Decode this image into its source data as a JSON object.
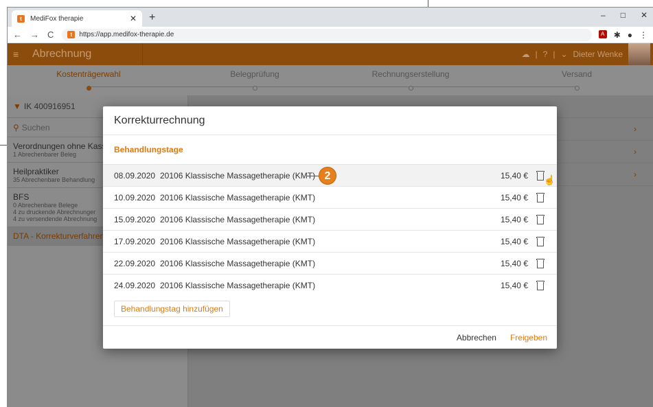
{
  "browser": {
    "tab_title": "MediFox therapie",
    "tab_favicon": "t",
    "url": "https://app.medifox-therapie.de",
    "new_tab": "+",
    "window_controls": [
      "–",
      "□",
      "✕"
    ]
  },
  "header": {
    "menu_icon": "≡",
    "title": "Abrechnung",
    "user": "Dieter Wenke"
  },
  "steps": [
    {
      "label": "Kostenträgerwahl"
    },
    {
      "label": "Belegprüfung"
    },
    {
      "label": "Rechnungserstellung"
    },
    {
      "label": "Versand"
    }
  ],
  "sidebar": {
    "filter": "IK 400916951",
    "search": "Suchen",
    "items": [
      {
        "title": "Verordnungen ohne Kasse",
        "sub": [
          "1 Abrechenbarer Beleg"
        ]
      },
      {
        "title": "Heilpraktiker",
        "sub": [
          "35 Abrechenbare Behandlung"
        ]
      },
      {
        "title": "BFS",
        "sub": [
          "0 Abrechenbare Belege",
          "4 zu druckende Abrechnunger",
          "4 zu versendende Abrechnung"
        ]
      },
      {
        "title": "DTA - Korrekturverfahren",
        "sub": []
      }
    ]
  },
  "modal": {
    "title": "Korrekturrechnung",
    "section": "Behandlungstage",
    "rows": [
      {
        "date": "08.09.2020",
        "desc": "20106 Klassische Massagetherapie (KMT)",
        "amount": "15,40 €"
      },
      {
        "date": "10.09.2020",
        "desc": "20106 Klassische Massagetherapie (KMT)",
        "amount": "15,40 €"
      },
      {
        "date": "15.09.2020",
        "desc": "20106 Klassische Massagetherapie (KMT)",
        "amount": "15,40 €"
      },
      {
        "date": "17.09.2020",
        "desc": "20106 Klassische Massagetherapie (KMT)",
        "amount": "15,40 €"
      },
      {
        "date": "22.09.2020",
        "desc": "20106 Klassische Massagetherapie (KMT)",
        "amount": "15,40 €"
      },
      {
        "date": "24.09.2020",
        "desc": "20106 Klassische Massagetherapie (KMT)",
        "amount": "15,40 €"
      }
    ],
    "add_button": "Behandlungstag hinzufügen",
    "cancel": "Abbrechen",
    "release": "Freigeben",
    "callout_number": "2"
  },
  "colors": {
    "accent": "#e07a10",
    "header_bg": "#8c4c0b"
  }
}
